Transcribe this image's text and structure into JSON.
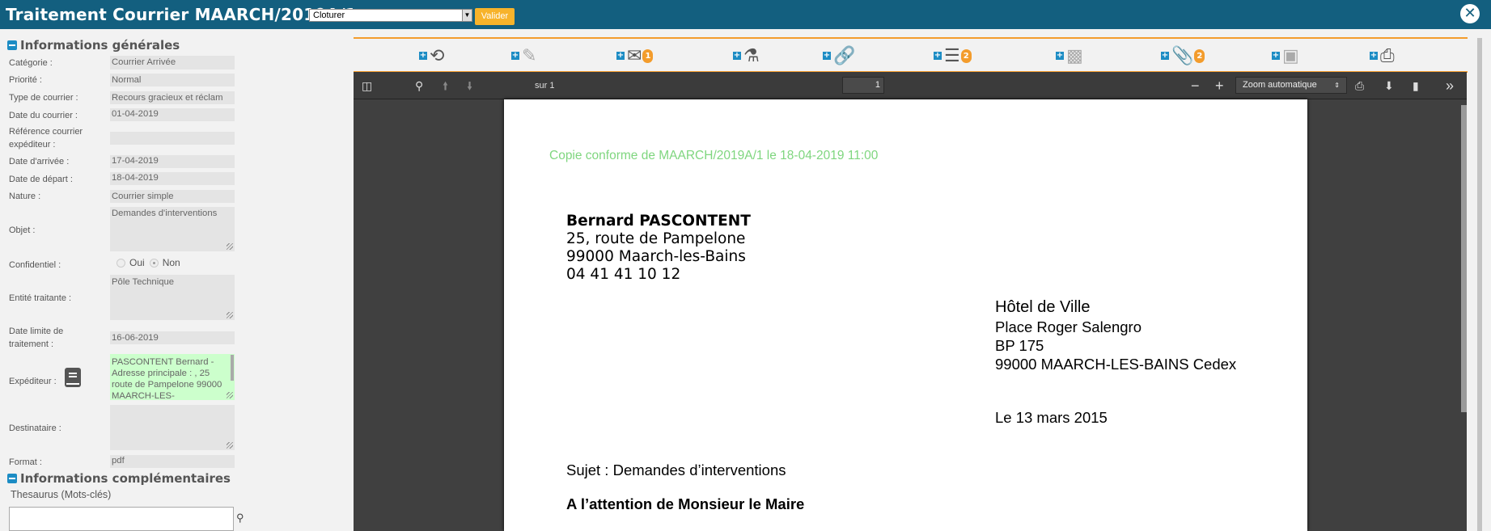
{
  "header": {
    "title": "Traitement Courrier MAARCH/2019A/1 :",
    "action_select": "Cloturer",
    "validate_label": "Valider",
    "close_icon": "close-circle-icon"
  },
  "sections": {
    "general": "Informations générales",
    "complementary": "Informations complémentaires"
  },
  "fields": [
    {
      "label": "Catégorie :",
      "value": "Courrier Arrivée"
    },
    {
      "label": "Priorité :",
      "value": "Normal"
    },
    {
      "label": "Type de courrier :",
      "value": "Recours gracieux et réclam"
    },
    {
      "label": "Date du courrier :",
      "value": "01-04-2019"
    },
    {
      "label": "Référence courrier expéditeur :",
      "value": ""
    },
    {
      "label": "Date d'arrivée :",
      "value": "17-04-2019"
    },
    {
      "label": "Date de départ :",
      "value": "18-04-2019"
    },
    {
      "label": "Nature :",
      "value": "Courrier simple"
    },
    {
      "label": "Objet :",
      "value": "Demandes d'interventions"
    },
    {
      "label": "Confidentiel :",
      "options": [
        "Oui",
        "Non"
      ],
      "selected": "Non"
    },
    {
      "label": "Entité traitante :",
      "value": "Pôle Technique"
    },
    {
      "label": "Date limite de traitement :",
      "value": "16-06-2019"
    },
    {
      "label": "Expéditeur :",
      "value": "PASCONTENT Bernard - Adresse principale : , 25 route de Pampelone 99000 MAARCH-LES-"
    },
    {
      "label": "Destinataire :",
      "value": ""
    },
    {
      "label": "Format :",
      "value": "pdf"
    }
  ],
  "thesaurus": {
    "label": "Thesaurus (Mots-clés)",
    "value": ""
  },
  "toolbar": [
    {
      "icon": "history-icon"
    },
    {
      "icon": "pencil-icon"
    },
    {
      "icon": "envelope-icon",
      "badge": "1"
    },
    {
      "icon": "share-icon"
    },
    {
      "icon": "link-icon"
    },
    {
      "icon": "list-icon",
      "badge": "2"
    },
    {
      "icon": "comment-icon"
    },
    {
      "icon": "paperclip-icon",
      "badge": "2"
    },
    {
      "icon": "suitcase-icon"
    },
    {
      "icon": "printer-icon"
    }
  ],
  "pdf": {
    "page": "1",
    "of": "sur 1",
    "zoom": "Zoom automatique"
  },
  "letter": {
    "stamp": "Copie conforme de MAARCH/2019A/1 le 18-04-2019 11:00",
    "sender": [
      "Bernard PASCONTENT",
      "25, route de Pampelone",
      "99000 Maarch-les-Bains",
      "04 41 41 10 12"
    ],
    "recipient": [
      "Hôtel de Ville",
      "Place Roger Salengro",
      "BP 175",
      "99000 MAARCH-LES-BAINS Cedex"
    ],
    "date": "Le 13 mars 2015",
    "subject": "Sujet : Demandes d’interventions",
    "attention": "A l’attention de Monsieur le Maire"
  },
  "colors": {
    "header": "#135f7f",
    "accent": "#f39c2c",
    "stamp": "#7fd67f",
    "sender_box": "#ccffcc"
  }
}
